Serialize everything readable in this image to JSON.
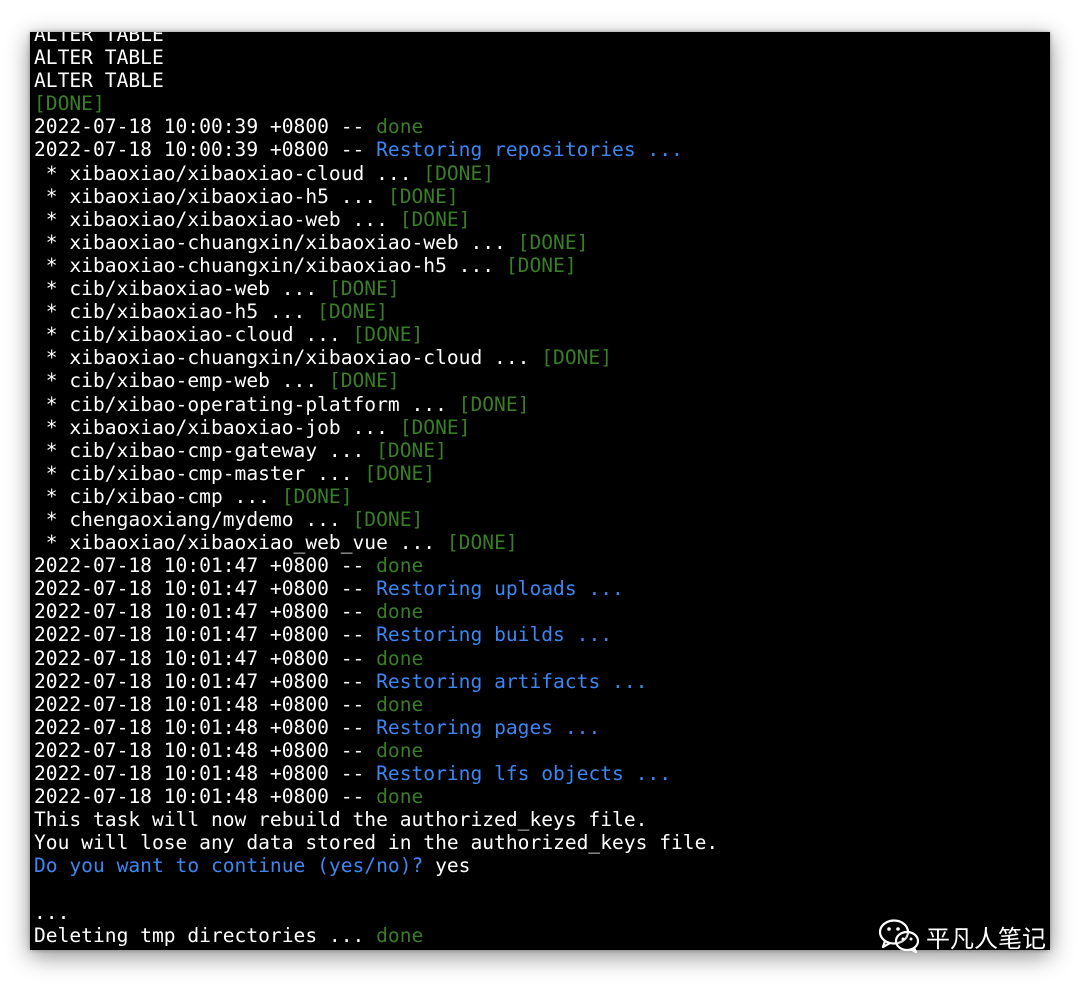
{
  "terminal": {
    "lines": [
      [
        {
          "t": "ALTER TABLE",
          "c": "w"
        }
      ],
      [
        {
          "t": "ALTER TABLE",
          "c": "w"
        }
      ],
      [
        {
          "t": "ALTER TABLE",
          "c": "w"
        }
      ],
      [
        {
          "t": "[DONE]",
          "c": "g"
        }
      ],
      [
        {
          "t": "2022-07-18 10:00:39 +0800 -- ",
          "c": "w"
        },
        {
          "t": "done",
          "c": "g"
        }
      ],
      [
        {
          "t": "2022-07-18 10:00:39 +0800 -- ",
          "c": "w"
        },
        {
          "t": "Restoring repositories ...",
          "c": "b"
        }
      ],
      [
        {
          "t": " * xibaoxiao/xibaoxiao-cloud ... ",
          "c": "w"
        },
        {
          "t": "[DONE]",
          "c": "g"
        }
      ],
      [
        {
          "t": " * xibaoxiao/xibaoxiao-h5 ... ",
          "c": "w"
        },
        {
          "t": "[DONE]",
          "c": "g"
        }
      ],
      [
        {
          "t": " * xibaoxiao/xibaoxiao-web ... ",
          "c": "w"
        },
        {
          "t": "[DONE]",
          "c": "g"
        }
      ],
      [
        {
          "t": " * xibaoxiao-chuangxin/xibaoxiao-web ... ",
          "c": "w"
        },
        {
          "t": "[DONE]",
          "c": "g"
        }
      ],
      [
        {
          "t": " * xibaoxiao-chuangxin/xibaoxiao-h5 ... ",
          "c": "w"
        },
        {
          "t": "[DONE]",
          "c": "g"
        }
      ],
      [
        {
          "t": " * cib/xibaoxiao-web ... ",
          "c": "w"
        },
        {
          "t": "[DONE]",
          "c": "g"
        }
      ],
      [
        {
          "t": " * cib/xibaoxiao-h5 ... ",
          "c": "w"
        },
        {
          "t": "[DONE]",
          "c": "g"
        }
      ],
      [
        {
          "t": " * cib/xibaoxiao-cloud ... ",
          "c": "w"
        },
        {
          "t": "[DONE]",
          "c": "g"
        }
      ],
      [
        {
          "t": " * xibaoxiao-chuangxin/xibaoxiao-cloud ... ",
          "c": "w"
        },
        {
          "t": "[DONE]",
          "c": "g"
        }
      ],
      [
        {
          "t": " * cib/xibao-emp-web ... ",
          "c": "w"
        },
        {
          "t": "[DONE]",
          "c": "g"
        }
      ],
      [
        {
          "t": " * cib/xibao-operating-platform ... ",
          "c": "w"
        },
        {
          "t": "[DONE]",
          "c": "g"
        }
      ],
      [
        {
          "t": " * xibaoxiao/xibaoxiao-job ... ",
          "c": "w"
        },
        {
          "t": "[DONE]",
          "c": "g"
        }
      ],
      [
        {
          "t": " * cib/xibao-cmp-gateway ... ",
          "c": "w"
        },
        {
          "t": "[DONE]",
          "c": "g"
        }
      ],
      [
        {
          "t": " * cib/xibao-cmp-master ... ",
          "c": "w"
        },
        {
          "t": "[DONE]",
          "c": "g"
        }
      ],
      [
        {
          "t": " * cib/xibao-cmp ... ",
          "c": "w"
        },
        {
          "t": "[DONE]",
          "c": "g"
        }
      ],
      [
        {
          "t": " * chengaoxiang/mydemo ... ",
          "c": "w"
        },
        {
          "t": "[DONE]",
          "c": "g"
        }
      ],
      [
        {
          "t": " * xibaoxiao/xibaoxiao_web_vue ... ",
          "c": "w"
        },
        {
          "t": "[DONE]",
          "c": "g"
        }
      ],
      [
        {
          "t": "2022-07-18 10:01:47 +0800 -- ",
          "c": "w"
        },
        {
          "t": "done",
          "c": "g"
        }
      ],
      [
        {
          "t": "2022-07-18 10:01:47 +0800 -- ",
          "c": "w"
        },
        {
          "t": "Restoring uploads ...",
          "c": "b"
        }
      ],
      [
        {
          "t": "2022-07-18 10:01:47 +0800 -- ",
          "c": "w"
        },
        {
          "t": "done",
          "c": "g"
        }
      ],
      [
        {
          "t": "2022-07-18 10:01:47 +0800 -- ",
          "c": "w"
        },
        {
          "t": "Restoring builds ...",
          "c": "b"
        }
      ],
      [
        {
          "t": "2022-07-18 10:01:47 +0800 -- ",
          "c": "w"
        },
        {
          "t": "done",
          "c": "g"
        }
      ],
      [
        {
          "t": "2022-07-18 10:01:47 +0800 -- ",
          "c": "w"
        },
        {
          "t": "Restoring artifacts ...",
          "c": "b"
        }
      ],
      [
        {
          "t": "2022-07-18 10:01:48 +0800 -- ",
          "c": "w"
        },
        {
          "t": "done",
          "c": "g"
        }
      ],
      [
        {
          "t": "2022-07-18 10:01:48 +0800 -- ",
          "c": "w"
        },
        {
          "t": "Restoring pages ...",
          "c": "b"
        }
      ],
      [
        {
          "t": "2022-07-18 10:01:48 +0800 -- ",
          "c": "w"
        },
        {
          "t": "done",
          "c": "g"
        }
      ],
      [
        {
          "t": "2022-07-18 10:01:48 +0800 -- ",
          "c": "w"
        },
        {
          "t": "Restoring lfs objects ...",
          "c": "b"
        }
      ],
      [
        {
          "t": "2022-07-18 10:01:48 +0800 -- ",
          "c": "w"
        },
        {
          "t": "done",
          "c": "g"
        }
      ],
      [
        {
          "t": "This task will now rebuild the authorized_keys file.",
          "c": "w"
        }
      ],
      [
        {
          "t": "You will lose any data stored in the authorized_keys file.",
          "c": "w"
        }
      ],
      [
        {
          "t": "Do you want to continue (yes/no)?",
          "c": "b"
        },
        {
          "t": " yes",
          "c": "w"
        }
      ],
      [],
      [
        {
          "t": "...",
          "c": "w"
        }
      ],
      [
        {
          "t": "Deleting tmp directories ... ",
          "c": "w"
        },
        {
          "t": "done",
          "c": "g"
        }
      ]
    ]
  },
  "colors": {
    "background": "#000000",
    "text": "#ffffff",
    "success": "#3a7d27",
    "info": "#3d86f2"
  },
  "watermark": {
    "icon": "wechat-icon",
    "text": "平凡人笔记"
  }
}
